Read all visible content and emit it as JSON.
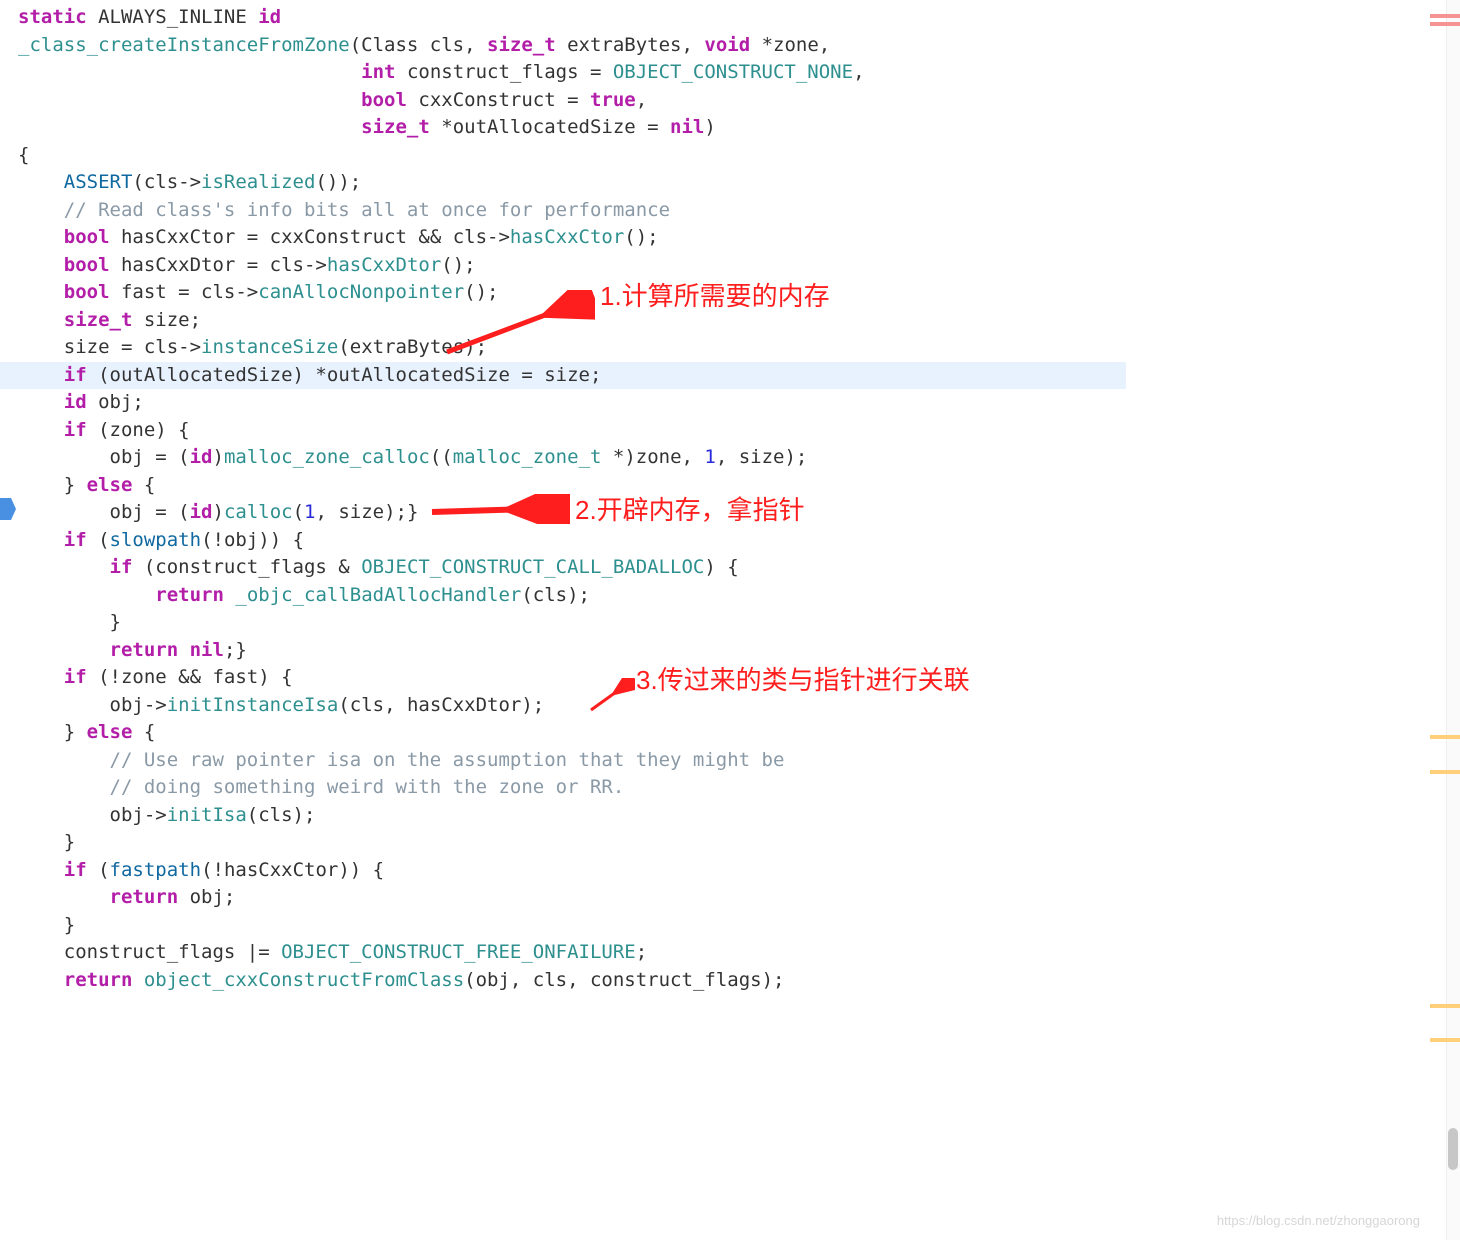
{
  "code": {
    "l1a": "static",
    "l1b": " ALWAYS_INLINE ",
    "l1c": "id",
    "l2a": "_class_createInstanceFromZone",
    "l2b": "(Class cls, ",
    "l2c": "size_t",
    "l2d": " extraBytes, ",
    "l2e": "void",
    "l2f": " *zone,",
    "l3a": "                              ",
    "l3b": "int",
    "l3c": " construct_flags = ",
    "l3d": "OBJECT_CONSTRUCT_NONE",
    "l3e": ",",
    "l4a": "                              ",
    "l4b": "bool",
    "l4c": " cxxConstruct = ",
    "l4d": "true",
    "l4e": ",",
    "l5a": "                              ",
    "l5b": "size_t",
    "l5c": " *outAllocatedSize = ",
    "l5d": "nil",
    "l5e": ")",
    "l6": "{",
    "l7a": "    ",
    "l7b": "ASSERT",
    "l7c": "(cls->",
    "l7d": "isRealized",
    "l7e": "());",
    "l8a": "    ",
    "l8b": "// Read class's info bits all at once for performance",
    "l9a": "    ",
    "l9b": "bool",
    "l9c": " hasCxxCtor = cxxConstruct && cls->",
    "l9d": "hasCxxCtor",
    "l9e": "();",
    "l10a": "    ",
    "l10b": "bool",
    "l10c": " hasCxxDtor = cls->",
    "l10d": "hasCxxDtor",
    "l10e": "();",
    "l11a": "    ",
    "l11b": "bool",
    "l11c": " fast = cls->",
    "l11d": "canAllocNonpointer",
    "l11e": "();",
    "l12a": "    ",
    "l12b": "size_t",
    "l12c": " size;",
    "l13a": "    size = cls->",
    "l13b": "instanceSize",
    "l13c": "(extraBytes);",
    "l14a": "    ",
    "l14b": "if",
    "l14c": " (outAllocatedSize) *outAllocatedSize = size;",
    "l15a": "    ",
    "l15b": "id",
    "l15c": " obj;",
    "l16a": "    ",
    "l16b": "if",
    "l16c": " (zone) {",
    "l17a": "        obj = (",
    "l17b": "id",
    "l17c": ")",
    "l17d": "malloc_zone_calloc",
    "l17e": "((",
    "l17f": "malloc_zone_t",
    "l17g": " *)zone, ",
    "l17h": "1",
    "l17i": ", size);",
    "l18a": "    } ",
    "l18b": "else",
    "l18c": " {",
    "l19a": "        obj = (",
    "l19b": "id",
    "l19c": ")",
    "l19d": "calloc",
    "l19e": "(",
    "l19f": "1",
    "l19g": ", size);}",
    "l20a": "    ",
    "l20b": "if",
    "l20c": " (",
    "l20d": "slowpath",
    "l20e": "(!obj)) {",
    "l21a": "        ",
    "l21b": "if",
    "l21c": " (construct_flags & ",
    "l21d": "OBJECT_CONSTRUCT_CALL_BADALLOC",
    "l21e": ") {",
    "l22a": "            ",
    "l22b": "return",
    "l22c": " ",
    "l22d": "_objc_callBadAllocHandler",
    "l22e": "(cls);",
    "l23": "        }",
    "l24a": "        ",
    "l24b": "return",
    "l24c": " ",
    "l24d": "nil",
    "l24e": ";}",
    "l25a": "    ",
    "l25b": "if",
    "l25c": " (!zone && fast) {",
    "l26a": "        obj->",
    "l26b": "initInstanceIsa",
    "l26c": "(cls, hasCxxDtor);",
    "l27a": "    } ",
    "l27b": "else",
    "l27c": " {",
    "l28a": "        ",
    "l28b": "// Use raw pointer isa on the assumption that they might be",
    "l29a": "        ",
    "l29b": "// doing something weird with the zone or RR.",
    "l30a": "        obj->",
    "l30b": "initIsa",
    "l30c": "(cls);",
    "l31": "    }",
    "l32a": "    ",
    "l32b": "if",
    "l32c": " (",
    "l32d": "fastpath",
    "l32e": "(!hasCxxCtor)) {",
    "l33a": "        ",
    "l33b": "return",
    "l33c": " obj;",
    "l34": "    }",
    "l35a": "    construct_flags |= ",
    "l35b": "OBJECT_CONSTRUCT_FREE_ONFAILURE",
    "l35c": ";",
    "l36a": "    ",
    "l36b": "return",
    "l36c": " ",
    "l36d": "object_cxxConstructFromClass",
    "l36e": "(obj, cls, construct_flags);"
  },
  "annotations": {
    "a1": "1.计算所需要的内存",
    "a2": "2.开辟内存，拿指针",
    "a3": "3.传过来的类与指针进行关联"
  },
  "watermark": "https://blog.csdn.net/zhonggaorong"
}
